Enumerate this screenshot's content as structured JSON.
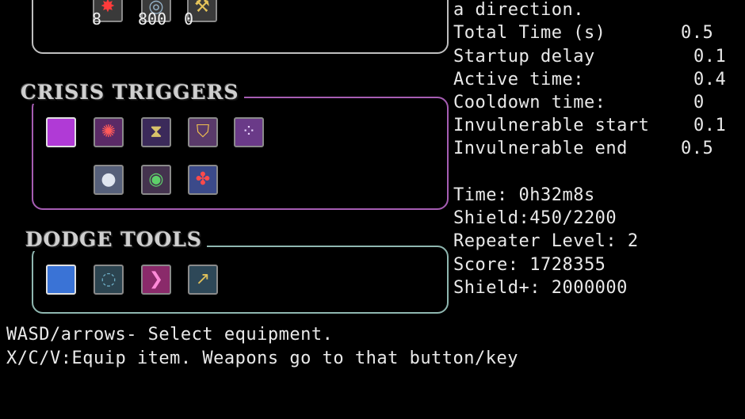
{
  "top_equipment": {
    "items": [
      {
        "icon": "bomb-icon",
        "count": "8"
      },
      {
        "icon": "orb-icon",
        "count": "800"
      },
      {
        "icon": "wrench-icon",
        "count": "0"
      }
    ]
  },
  "crisis_triggers": {
    "title": "CRISIS TRIGGERS",
    "row1": [
      "filled-square-icon",
      "burst-icon",
      "hourglass-icon",
      "shield-icon",
      "dots-icon"
    ],
    "row2": [
      "sphere-icon",
      "eye-icon",
      "swirl-icon"
    ]
  },
  "dodge_tools": {
    "title": "DODGE TOOLS",
    "items": [
      "blue-square-icon",
      "ring-icon",
      "chevrons-icon",
      "boot-icon"
    ]
  },
  "item_details": {
    "description_tail": "a direction.",
    "stats": [
      {
        "label": "Total Time (s)",
        "value": "0.5"
      },
      {
        "label": "Startup delay",
        "value": "0.1"
      },
      {
        "label": "Active time:",
        "value": "0.4"
      },
      {
        "label": "Cooldown time:",
        "value": "0"
      },
      {
        "label": "Invulnerable start",
        "value": "0.1"
      },
      {
        "label": "Invulnerable end",
        "value": "0.5"
      }
    ]
  },
  "status": {
    "time": "Time: 0h32m8s",
    "shield": "Shield:450/2200",
    "repeater": "Repeater Level: 2",
    "score": "Score: 1728355",
    "shield_plus": "Shield+: 2000000"
  },
  "help": {
    "line1": "WASD/arrows- Select equipment.",
    "line2": "X/C/V:Equip item. Weapons go to that button/key"
  },
  "colors": {
    "crisis_border": "#a65db3",
    "dodge_border": "#8fb7b0",
    "selected_crisis": "#b03ad6",
    "selected_dodge": "#3a73d6"
  }
}
